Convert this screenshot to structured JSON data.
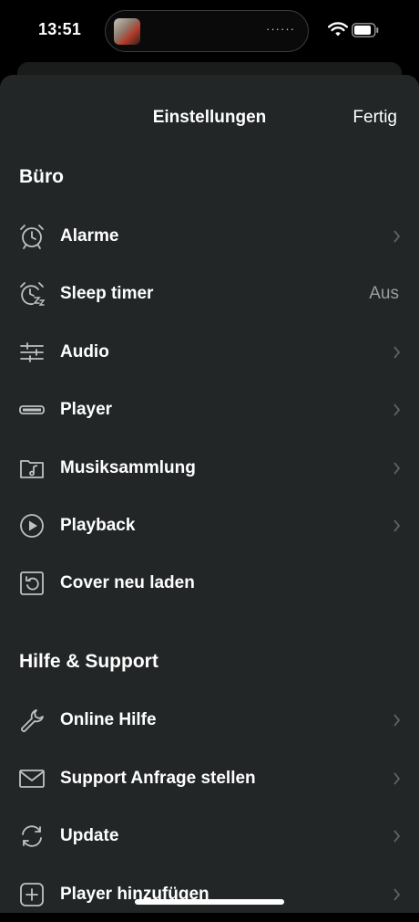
{
  "status": {
    "time": "13:51",
    "island_dots": "······"
  },
  "nav": {
    "title": "Einstellungen",
    "done": "Fertig"
  },
  "sections": [
    {
      "title": "Büro",
      "items": [
        {
          "label": "Alarme",
          "icon": "alarm-clock-icon",
          "chevron": true
        },
        {
          "label": "Sleep timer",
          "icon": "sleep-timer-icon",
          "value": "Aus"
        },
        {
          "label": "Audio",
          "icon": "sliders-icon",
          "chevron": true
        },
        {
          "label": "Player",
          "icon": "player-device-icon",
          "chevron": true
        },
        {
          "label": "Musiksammlung",
          "icon": "music-folder-icon",
          "chevron": true
        },
        {
          "label": "Playback",
          "icon": "play-circle-icon",
          "chevron": true
        },
        {
          "label": "Cover neu laden",
          "icon": "reload-square-icon"
        }
      ]
    },
    {
      "title": "Hilfe & Support",
      "items": [
        {
          "label": "Online Hilfe",
          "icon": "wrench-icon",
          "chevron": true
        },
        {
          "label": "Support Anfrage stellen",
          "icon": "envelope-icon",
          "chevron": true
        },
        {
          "label": "Update",
          "icon": "sync-arrows-icon",
          "chevron": true
        },
        {
          "label": "Player hinzufügen",
          "icon": "plus-square-icon",
          "chevron": true
        }
      ]
    }
  ],
  "colors": {
    "sheet_bg": "#222626",
    "secondary_text": "#9a9d9d",
    "chevron": "#5e6262"
  }
}
